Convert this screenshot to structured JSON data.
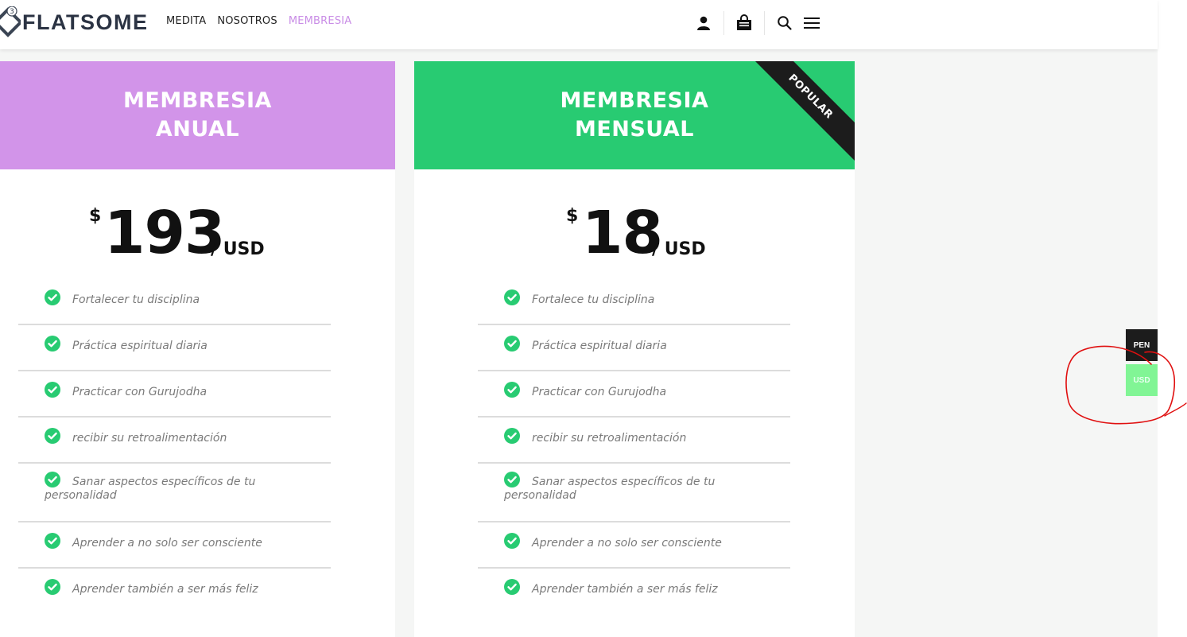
{
  "colors": {
    "accent_purple": "#d294e9",
    "accent_green": "#28cb72",
    "nav_active": "#c98de6",
    "check_green": "#28cb72",
    "annotation_red": "#e01010"
  },
  "header": {
    "logo_badge": "3",
    "logo_text": "FLATSOME",
    "nav": [
      {
        "label": "MEDITA"
      },
      {
        "label": "NOSOTROS"
      },
      {
        "label": "MEMBRESIA",
        "active": true
      }
    ],
    "icons": [
      "user-icon",
      "shopping-bag-icon",
      "search-icon",
      "menu-icon"
    ]
  },
  "plans": [
    {
      "title_line1": "MEMBRESIA",
      "title_line2": "ANUAL",
      "currency_symbol": "$",
      "amount": "193",
      "period": "/ USD",
      "features": [
        "Fortalecer tu disciplina",
        "Práctica espiritual diaria",
        "Practicar con Gurujodha",
        "recibir su retroalimentación",
        "Sanar aspectos específicos de tu personalidad",
        "Aprender a no solo ser consciente",
        "Aprender también a ser más feliz"
      ]
    },
    {
      "title_line1": "MEMBRESIA",
      "title_line2": "MENSUAL",
      "ribbon": "POPULAR",
      "currency_symbol": "$",
      "amount": "18",
      "period": "/ USD",
      "features": [
        "Fortalece tu disciplina",
        "Práctica espiritual diaria",
        "Practicar con Gurujodha",
        "recibir su retroalimentación",
        "Sanar aspectos específicos de tu personalidad",
        "Aprender a no solo ser consciente",
        "Aprender también a ser más feliz"
      ]
    }
  ],
  "currency_switcher": {
    "options": [
      "PEN",
      "USD"
    ],
    "selected": "USD"
  }
}
